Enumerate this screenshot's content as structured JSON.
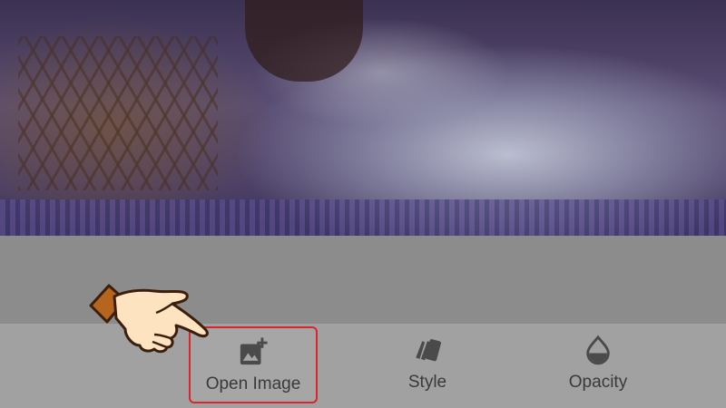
{
  "toolbar": {
    "items": [
      {
        "label": "Open Image",
        "icon": "add-photo-icon"
      },
      {
        "label": "Style",
        "icon": "style-icon"
      },
      {
        "label": "Opacity",
        "icon": "opacity-icon"
      }
    ],
    "highlight_color": "#d9262c"
  },
  "overlay": {
    "pointer": "pointing-hand-icon"
  }
}
